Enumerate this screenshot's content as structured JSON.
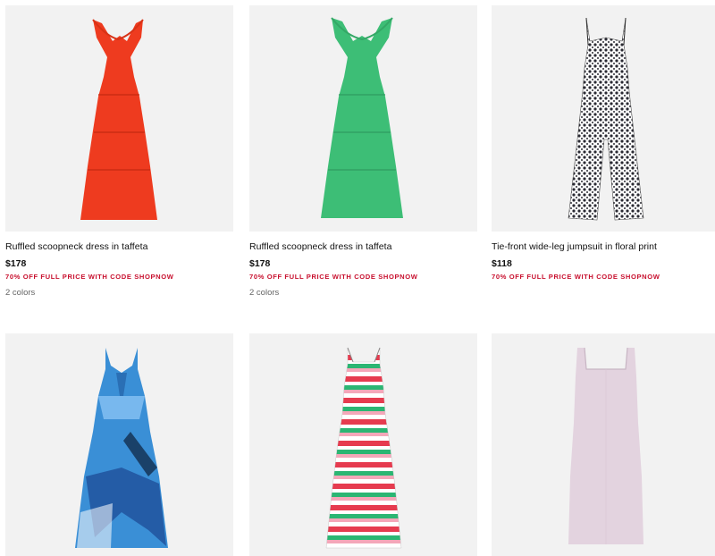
{
  "products": [
    {
      "name": "Ruffled scoopneck dress in taffeta",
      "price": "$178",
      "promo": "70% OFF FULL PRICE WITH CODE SHOPNOW",
      "colors": "2 colors",
      "image_color": "#ee3b1f"
    },
    {
      "name": "Ruffled scoopneck dress in taffeta",
      "price": "$178",
      "promo": "70% OFF FULL PRICE WITH CODE SHOPNOW",
      "colors": "2 colors",
      "image_color": "#3dbe76"
    },
    {
      "name": "Tie-front wide-leg jumpsuit in floral print",
      "price": "$118",
      "promo": "70% OFF FULL PRICE WITH CODE SHOPNOW",
      "colors": "",
      "image_color": "#9a9a9a"
    },
    {
      "image_color": "#3a8fd6"
    },
    {
      "image_color": "#e63b4f"
    },
    {
      "image_color": "#e3d3df"
    }
  ]
}
